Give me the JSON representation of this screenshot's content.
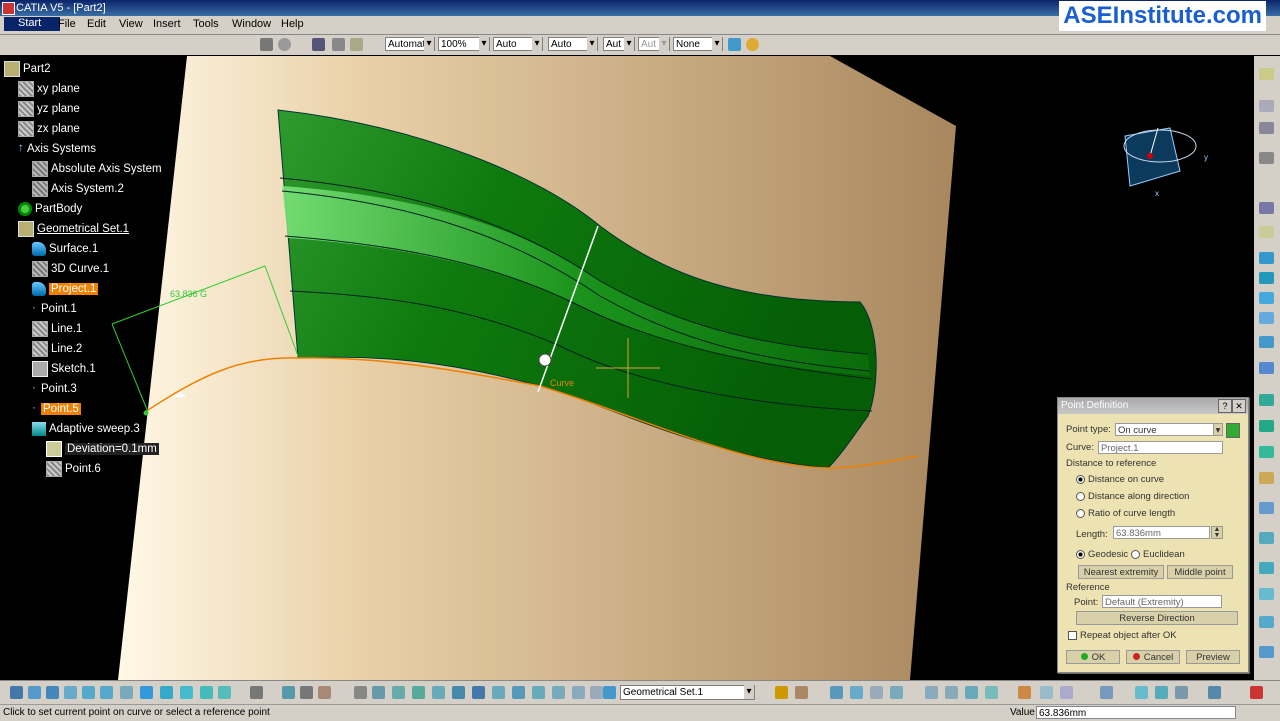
{
  "window": {
    "title": "CATIA V5 - [Part2]",
    "brand": "ASEInstitute.com"
  },
  "menu": {
    "items": [
      "Start",
      "File",
      "Edit",
      "View",
      "Insert",
      "Tools",
      "Window",
      "Help"
    ]
  },
  "toolbar": {
    "combos": [
      {
        "name": "material-combo",
        "value": "Automat"
      },
      {
        "name": "zoom-combo",
        "value": "100%"
      },
      {
        "name": "linetype-combo",
        "value": "Auto"
      },
      {
        "name": "thickness-combo",
        "value": "Auto"
      },
      {
        "name": "point-combo",
        "value": "Aut"
      },
      {
        "name": "layer-combo",
        "value": "Aut"
      },
      {
        "name": "color-combo",
        "value": "None"
      }
    ]
  },
  "tree": {
    "nodes": [
      {
        "label": "Part2",
        "icon": "part-icon"
      },
      {
        "label": "xy plane",
        "icon": "plane-icon"
      },
      {
        "label": "yz plane",
        "icon": "plane-icon"
      },
      {
        "label": "zx plane",
        "icon": "plane-icon"
      },
      {
        "label": "Axis Systems",
        "icon": "axis-systems-icon"
      },
      {
        "label": "Absolute Axis System",
        "icon": "axis-system-icon"
      },
      {
        "label": "Axis System.2",
        "icon": "axis-system-icon"
      },
      {
        "label": "PartBody",
        "icon": "partbody-icon"
      },
      {
        "label": "Geometrical Set.1",
        "icon": "geometrical-set-icon"
      },
      {
        "label": "Surface.1",
        "icon": "surface-icon"
      },
      {
        "label": "3D Curve.1",
        "icon": "curve-icon"
      },
      {
        "label": "Project.1",
        "icon": "project-icon"
      },
      {
        "label": "Point.1",
        "icon": "point-icon"
      },
      {
        "label": "Line.1",
        "icon": "line-icon"
      },
      {
        "label": "Line.2",
        "icon": "line-icon"
      },
      {
        "label": "Sketch.1",
        "icon": "sketch-icon"
      },
      {
        "label": "Point.3",
        "icon": "point-icon"
      },
      {
        "label": "Point.5",
        "icon": "point-icon"
      },
      {
        "label": "Adaptive sweep.3",
        "icon": "sweep-icon"
      },
      {
        "label": "Deviation=0.1mm",
        "icon": "deviation-icon"
      },
      {
        "label": "Point.6",
        "icon": "point-icon"
      }
    ]
  },
  "viewport": {
    "dimension_label": "63.836 G",
    "curve_label": "Curve",
    "compass": {
      "x_label": "x",
      "y_label": "y"
    }
  },
  "dialog": {
    "title": "Point Definition",
    "help": "?",
    "close": "✕",
    "point_type_label": "Point type:",
    "point_type_value": "On curve",
    "curve_label": "Curve:",
    "curve_value": "Project.1",
    "distance_group": "Distance to reference",
    "opt_distance_on_curve": "Distance on curve",
    "opt_distance_along_direction": "Distance along direction",
    "opt_ratio": "Ratio of curve length",
    "length_label": "Length:",
    "length_value": "63.836mm",
    "geodesic": "Geodesic",
    "euclidean": "Euclidean",
    "nearest_extremity": "Nearest extremity",
    "middle_point": "Middle point",
    "reference_group": "Reference",
    "point_label": "Point:",
    "point_value": "Default (Extremity)",
    "reverse_direction": "Reverse Direction",
    "repeat_label": "Repeat object after OK",
    "ok": "OK",
    "cancel": "Cancel",
    "preview": "Preview"
  },
  "bottom": {
    "set_combo": "Geometrical Set.1"
  },
  "status": {
    "message": "Click to set current point on curve or select a reference point",
    "value_label": "Value",
    "value": "63.836mm"
  }
}
